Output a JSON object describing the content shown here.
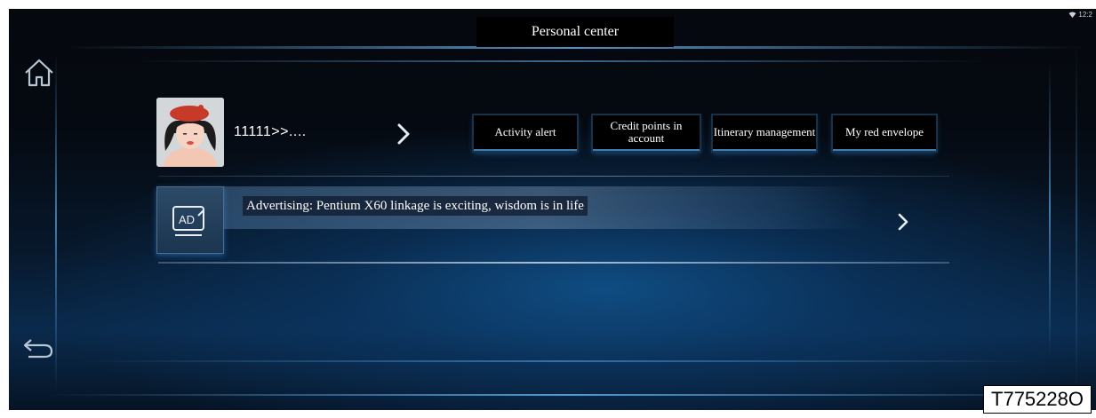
{
  "header": {
    "title": "Personal center",
    "status_time": "12:2"
  },
  "profile": {
    "username": "11111>>...."
  },
  "menu": [
    {
      "label": "Activity alert"
    },
    {
      "label": "Credit points in account"
    },
    {
      "label": "Itinerary management"
    },
    {
      "label": "My red envelope"
    }
  ],
  "advertising": {
    "icon_label": "AD",
    "text": "Advertising: Pentium X60 linkage is exciting, wisdom is in life"
  },
  "figure_code": "T775228O",
  "icons": [
    "home-icon",
    "back-icon",
    "wifi-icon",
    "chevron-right-icon",
    "ad-icon",
    "avatar"
  ],
  "colors": {
    "background": "#050a12",
    "accent_glow": "#6ebeff",
    "button_bg": "#000000",
    "text": "#ffffff"
  }
}
